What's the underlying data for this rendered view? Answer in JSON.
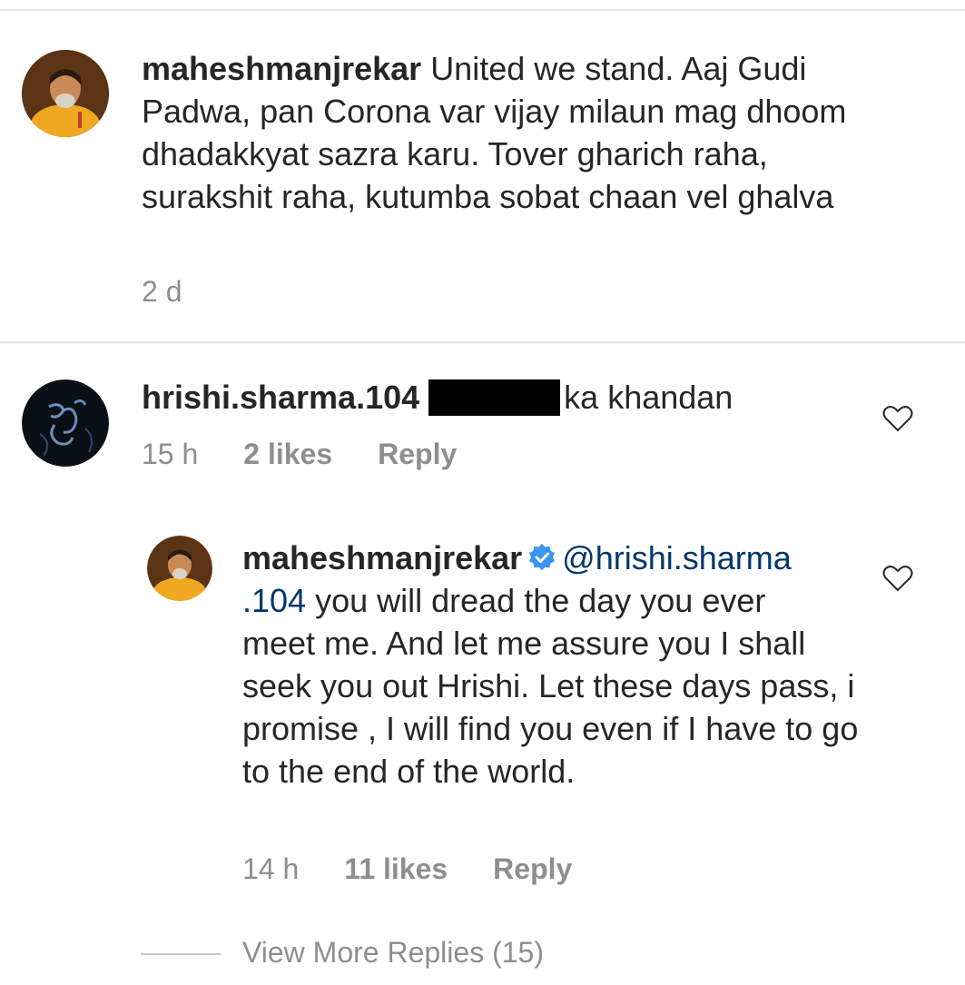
{
  "comments": [
    {
      "username": "maheshmanjrekar",
      "text": "United we stand. Aaj Gudi Padwa, pan Corona var vijay milaun mag dhoom dhadakkyat sazra karu. Tover gharich raha, surakshit raha, kutumba sobat chaan vel ghalva",
      "time": "2 d"
    },
    {
      "username": "hrishi.sharma.104",
      "text": "ka khandan",
      "time": "15 h",
      "likes": "2 likes",
      "reply": "Reply"
    }
  ],
  "reply": {
    "username": "maheshmanjrekar",
    "verified_icon": "verified-badge-icon",
    "mention_part1": "@hrishi.sharma",
    "mention_part2": ".104",
    "text_line1": " you will dread the day you ever",
    "text_rest": "meet me. And let me assure you I shall seek you out Hrishi. Let these days pass, i promise , I will find you even if I have to go to the end of the world.",
    "time": "14 h",
    "likes": "11 likes",
    "reply": "Reply"
  },
  "view_more": "View More Replies (15)",
  "colors": {
    "text": "#262626",
    "secondary": "#8e8e8e",
    "mention": "#00376b",
    "verified": "#3897f0"
  }
}
